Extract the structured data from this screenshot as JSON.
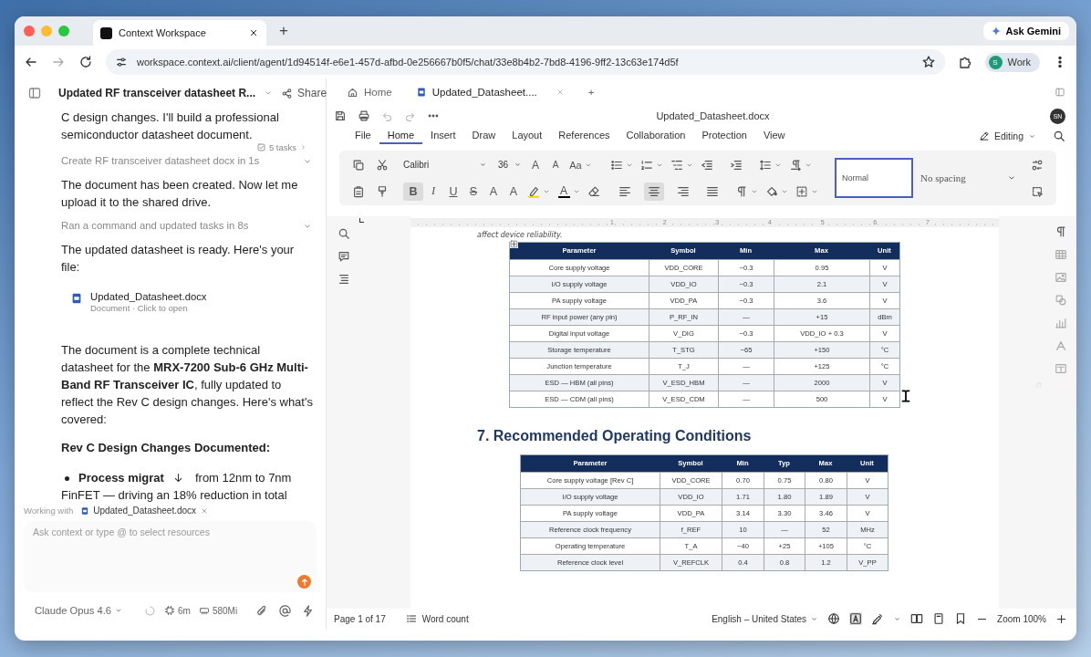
{
  "browser": {
    "tabs": [
      {
        "title": "Context Workspace",
        "selected": true
      }
    ],
    "new_tab": "+",
    "ask_gemini": "Ask Gemini",
    "url": "workspace.context.ai/client/agent/1d94514f-e6e1-457d-afbd-0e256667b0f5/chat/33e8b4b2-7bd8-4196-9ff2-13c63e174d5f",
    "profile": {
      "initial": "S",
      "label": "Work"
    }
  },
  "chat": {
    "title": "Updated RF transceiver datasheet R...",
    "share": "Share",
    "tasks_badge": "5 tasks",
    "messages": [
      {
        "kind": "text",
        "text": "C design changes. I'll build a professional semiconductor datasheet document."
      },
      {
        "kind": "step",
        "text": "Create RF transceiver datasheet docx in 1s"
      },
      {
        "kind": "text",
        "text": "The document has been created. Now let me upload it to the shared drive."
      },
      {
        "kind": "step",
        "text": "Ran a command and updated tasks in 8s"
      },
      {
        "kind": "text",
        "text": "The updated datasheet is ready. Here's your file:"
      },
      {
        "kind": "file",
        "name": "Updated_Datasheet.docx",
        "meta": "Document · Click to open"
      },
      {
        "kind": "text",
        "text": "The document is a complete technical datasheet for the **MRX-7200 Sub-6 GHz Multi-Band RF Transceiver IC**, fully updated to reflect the Rev C design changes. Here's what's covered:"
      },
      {
        "kind": "heading",
        "text": "Rev C Design Changes Documented:"
      },
      {
        "kind": "bullet",
        "lead": "Process migrat",
        "text": "from 12nm to 7nm",
        "continuation": "FinFET — driving an 18% reduction in total"
      }
    ],
    "working_with": {
      "label": "Working with",
      "file": "Updated_Datasheet.docx"
    },
    "input": {
      "placeholder": "Ask context or type @ to select resources"
    },
    "footer": {
      "model": "Claude Opus 4.6",
      "time": "6m",
      "memory": "580Mi"
    }
  },
  "editor": {
    "tabs": [
      {
        "label": "Home",
        "kind": "home",
        "selected": false
      },
      {
        "label": "Updated_Datasheet....",
        "kind": "document",
        "selected": true
      }
    ],
    "new_tab": "+",
    "filename": "Updated_Datasheet.docx",
    "avatar": "SN",
    "menu": [
      {
        "label": "File",
        "selected": false
      },
      {
        "label": "Home",
        "selected": true
      },
      {
        "label": "Insert",
        "selected": false
      },
      {
        "label": "Draw",
        "selected": false
      },
      {
        "label": "Layout",
        "selected": false
      },
      {
        "label": "References",
        "selected": false
      },
      {
        "label": "Collaboration",
        "selected": false
      },
      {
        "label": "Protection",
        "selected": false
      },
      {
        "label": "View",
        "selected": false
      }
    ],
    "mode": "Editing",
    "ribbon": {
      "font": "Calibri",
      "size": "36",
      "case_buttons": [
        {
          "label": "A",
          "kind": "grow"
        },
        {
          "label": "A",
          "kind": "shrink"
        },
        {
          "label": "Aa",
          "kind": "case"
        }
      ],
      "format_buttons": [
        {
          "label": "B",
          "kind": "bold",
          "selected": true
        },
        {
          "label": "I",
          "kind": "italic",
          "selected": false
        },
        {
          "label": "U",
          "kind": "underline",
          "selected": false
        },
        {
          "label": "S",
          "kind": "strike",
          "selected": false
        },
        {
          "label": "A",
          "kind": "superscript",
          "selected": false
        },
        {
          "label": "A",
          "kind": "subscript",
          "selected": false
        }
      ],
      "font_color": {
        "label": "A",
        "color": "#000000"
      },
      "align_buttons": [
        {
          "kind": "left",
          "selected": false
        },
        {
          "kind": "center",
          "selected": true
        },
        {
          "kind": "right",
          "selected": false
        },
        {
          "kind": "justify",
          "selected": false
        }
      ],
      "styles": [
        {
          "label": "Normal",
          "selected": true
        },
        {
          "label": "No spacing",
          "selected": false
        }
      ]
    },
    "ruler": [
      "1",
      "2",
      "3",
      "4",
      "5",
      "6",
      "7"
    ],
    "document": {
      "fragment": "affect device reliability.",
      "tables": [
        {
          "columns": [
            "Parameter",
            "Symbol",
            "Min",
            "Max",
            "Unit"
          ],
          "rows": [
            [
              "Core supply voltage",
              "VDD_CORE",
              "−0.3",
              "0.95",
              "V"
            ],
            [
              "I/O supply voltage",
              "VDD_IO",
              "−0.3",
              "2.1",
              "V"
            ],
            [
              "PA supply voltage",
              "VDD_PA",
              "−0.3",
              "3.6",
              "V"
            ],
            [
              "RF input power (any pin)",
              "P_RF_IN",
              "—",
              "+15",
              "dBm"
            ],
            [
              "Digital input voltage",
              "V_DIG",
              "−0.3",
              "VDD_IO + 0.3",
              "V"
            ],
            [
              "Storage temperature",
              "T_STG",
              "−65",
              "+150",
              "°C"
            ],
            [
              "Junction temperature",
              "T_J",
              "—",
              "+125",
              "°C"
            ],
            [
              "ESD — HBM (all pins)",
              "V_ESD_HBM",
              "—",
              "2000",
              "V"
            ],
            [
              "ESD — CDM (all pins)",
              "V_ESD_CDM",
              "—",
              "500",
              "V"
            ]
          ]
        },
        {
          "heading": "7. Recommended Operating Conditions",
          "columns": [
            "Parameter",
            "Symbol",
            "Min",
            "Typ",
            "Max",
            "Unit"
          ],
          "rows": [
            [
              "Core supply voltage [Rev C]",
              "VDD_CORE",
              "0.70",
              "0.75",
              "0.80",
              "V"
            ],
            [
              "I/O supply voltage",
              "VDD_IO",
              "1.71",
              "1.80",
              "1.89",
              "V"
            ],
            [
              "PA supply voltage",
              "VDD_PA",
              "3.14",
              "3.30",
              "3.46",
              "V"
            ],
            [
              "Reference clock frequency",
              "f_REF",
              "10",
              "—",
              "52",
              "MHz"
            ],
            [
              "Operating temperature",
              "T_A",
              "−40",
              "+25",
              "+105",
              "°C"
            ],
            [
              "Reference clock level",
              "V_REFCLK",
              "0.4",
              "0.8",
              "1.2",
              "V_PP"
            ]
          ]
        }
      ]
    },
    "status": {
      "page": "Page 1 of 17",
      "word_count": "Word count",
      "language": "English – United States",
      "zoom": "Zoom 100%"
    }
  }
}
